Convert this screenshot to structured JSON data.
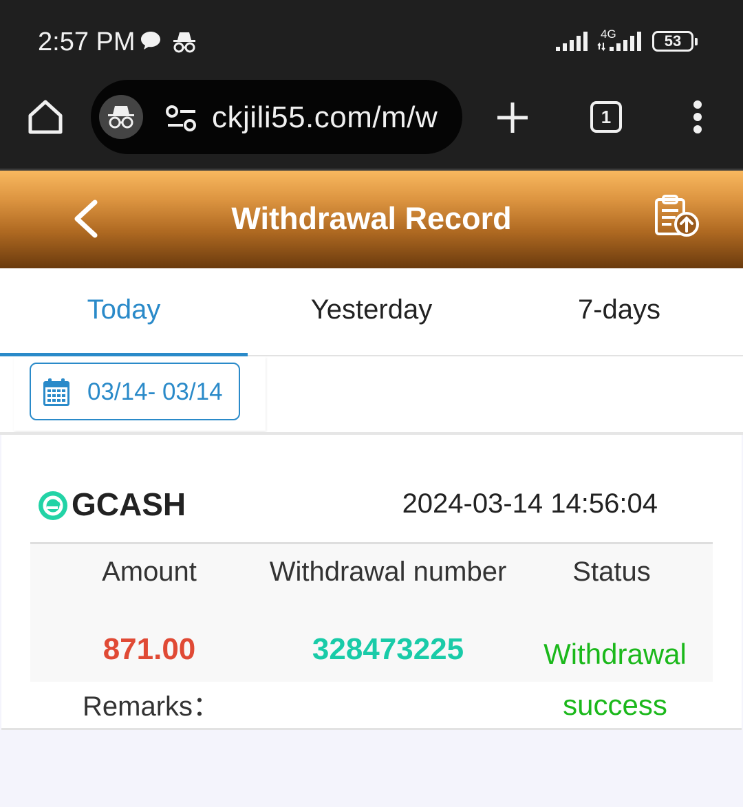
{
  "status_bar": {
    "time": "2:57 PM",
    "network": "4G",
    "battery": "53",
    "icons": [
      "chat-icon",
      "incognito-icon",
      "signal-icon",
      "signal-4g-icon",
      "battery-icon"
    ]
  },
  "browser": {
    "url": "ckjili55.com/m/w",
    "tab_count": "1",
    "icons": [
      "home-icon",
      "incognito-icon",
      "site-settings-icon",
      "plus-icon",
      "more-icon"
    ]
  },
  "header": {
    "title": "Withdrawal Record",
    "icons": [
      "back-icon",
      "record-upload-icon"
    ],
    "gradient": [
      "#f9b85f",
      "#6a3a0d"
    ]
  },
  "tabs": [
    {
      "label": "Today",
      "active": true
    },
    {
      "label": "Yesterday",
      "active": false
    },
    {
      "label": "7-days",
      "active": false
    }
  ],
  "date_filter": {
    "range": "03/14- 03/14",
    "icon": "calendar-icon"
  },
  "record": {
    "channel": "GCASH",
    "channel_icon": "gcash-icon",
    "datetime": "2024-03-14 14:56:04",
    "columns": [
      "Amount",
      "Withdrawal number",
      "Status"
    ],
    "amount": "871.00",
    "withdrawal_number": "328473225",
    "status_line1": "Withdrawal",
    "status_line2": "success",
    "remarks_label": "Remarks："
  },
  "colors": {
    "accent": "#2a8ac9",
    "amount": "#e04a35",
    "number": "#19cba8",
    "success": "#1bb81b"
  }
}
